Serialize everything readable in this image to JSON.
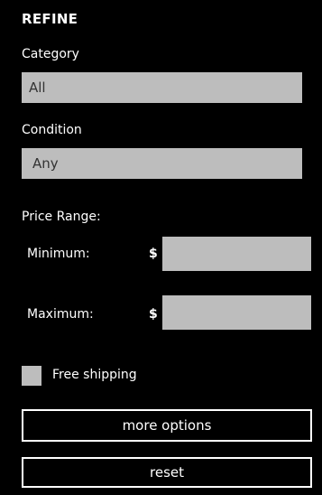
{
  "header": {
    "title": "REFINE"
  },
  "category": {
    "label": "Category",
    "value": "All"
  },
  "condition": {
    "label": "Condition",
    "value": "Any"
  },
  "price_range": {
    "label": "Price Range:",
    "minimum_label": "Minimum:",
    "maximum_label": "Maximum:",
    "currency_symbol": "$",
    "minimum_value": "",
    "maximum_value": ""
  },
  "free_shipping": {
    "label": "Free shipping",
    "checked": false
  },
  "buttons": {
    "more_options": "more options",
    "reset": "reset"
  },
  "colors": {
    "background": "#000000",
    "field": "#bdbdbd",
    "text": "#ffffff"
  }
}
